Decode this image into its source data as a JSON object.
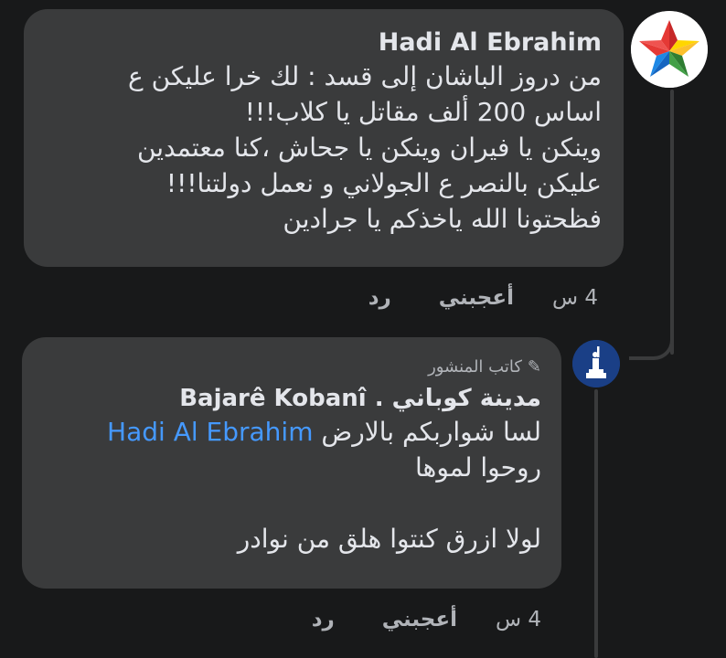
{
  "main_comment": {
    "author": "Hadi Al Ebrahim",
    "lines": [
      "من دروز الباشان إلى قسد : لك خرا عليكن ع",
      "اساس 200 ألف مقاتل يا كلاب!!!",
      "وينكن يا فيران وينكن يا جحاش ،كنا معتمدين",
      "عليكن بالنصر ع الجولاني و نعمل دولتنا!!!",
      "فظحتونا الله ياخذكم يا جرادين"
    ],
    "time": "4 س",
    "like_label": "أعجبني",
    "reply_label": "رد"
  },
  "reply_comment": {
    "badge": "كاتب المنشور",
    "author": "مدينة كوباني . Bajarê Kobanî",
    "line1_text": "لسا شواربكم بالارض",
    "mention": "Hadi Al Ebrahim",
    "line2": "روحوا  لموها",
    "line3": "لولا ازرق كنتوا هلق من نوادر",
    "time": "4 س",
    "like_label": "أعجبني",
    "reply_label": "رد"
  },
  "colors": {
    "background": "#18191a",
    "bubble": "#3a3b3c",
    "text": "#e4e6eb",
    "secondary_text": "#b0b3b8",
    "mention": "#4599ff",
    "thread_line": "#3a3b3c"
  },
  "icons": {
    "main_avatar": "multicolor-star-avatar",
    "reply_avatar": "statue-silhouette-avatar",
    "author_badge": "pencil-icon"
  }
}
